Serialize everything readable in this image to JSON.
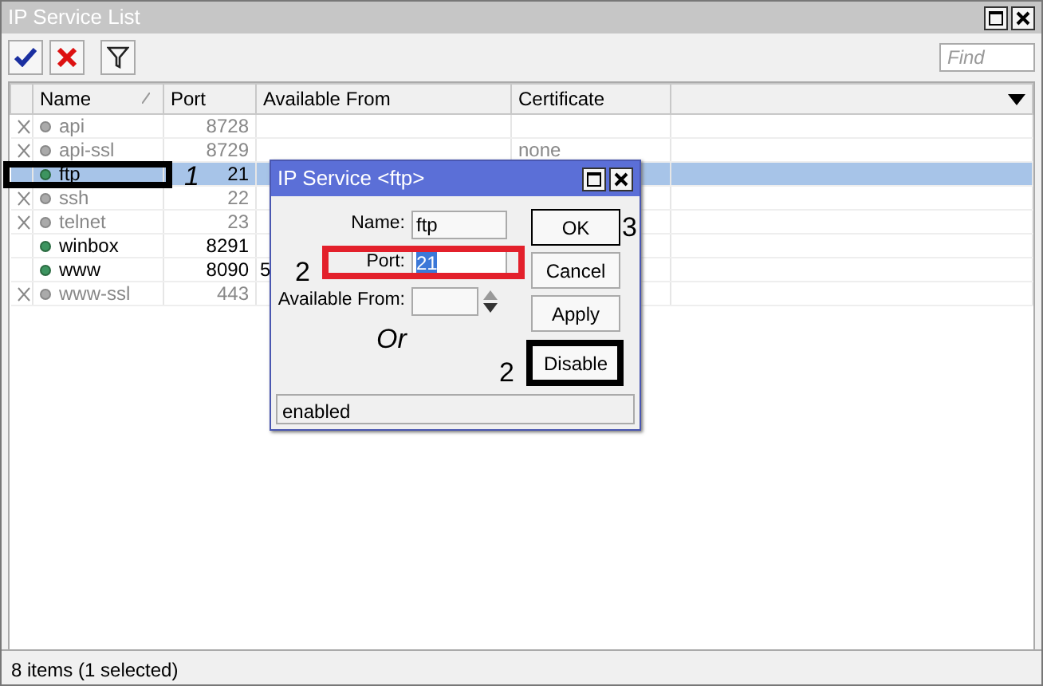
{
  "window": {
    "title": "IP Service List"
  },
  "toolbar": {
    "find": {
      "placeholder": "Find"
    }
  },
  "table": {
    "columns": [
      {
        "label": "Name",
        "sorted": true
      },
      {
        "label": "Port"
      },
      {
        "label": "Available From"
      },
      {
        "label": "Certificate"
      }
    ],
    "rows": [
      {
        "name": "api",
        "port": "8728",
        "disabled": true,
        "selected": false
      },
      {
        "name": "api-ssl",
        "port": "8729",
        "certificate": "none",
        "disabled": true,
        "selected": false
      },
      {
        "name": "ftp",
        "port": "21",
        "disabled": false,
        "selected": true,
        "note": "1",
        "color": "#000000",
        "thick_frame": true
      },
      {
        "name": "ssh",
        "port": "22",
        "disabled": true,
        "selected": false
      },
      {
        "name": "telnet",
        "port": "23",
        "disabled": true,
        "selected": false
      },
      {
        "name": "winbox",
        "port": "8291",
        "disabled": false,
        "selected": false
      },
      {
        "name": "www",
        "port": "8090",
        "available_from": "5",
        "disabled": false,
        "selected": false
      },
      {
        "name": "www-ssl",
        "port": "443",
        "disabled": true,
        "selected": false
      }
    ]
  },
  "status_bar": "8 items (1 selected)",
  "dialog": {
    "title": "IP Service <ftp>",
    "note": "Or",
    "fields": [
      {
        "kind": "text",
        "label": "Name:",
        "value": "ftp"
      },
      {
        "kind": "text",
        "label": "Port:",
        "value": "21",
        "text_selected": true,
        "note": "2",
        "color": "#e3202b",
        "thick_frame": true
      },
      {
        "kind": "spinner",
        "label": "Available From:"
      }
    ],
    "buttons": [
      {
        "label": "OK",
        "note": "3",
        "color": "#000000",
        "thick_frame": false
      },
      {
        "label": "Cancel"
      },
      {
        "label": "Apply"
      },
      {
        "label": "Disable",
        "note": "2",
        "color": "#000000",
        "thick_frame": true
      }
    ],
    "status": "enabled"
  }
}
